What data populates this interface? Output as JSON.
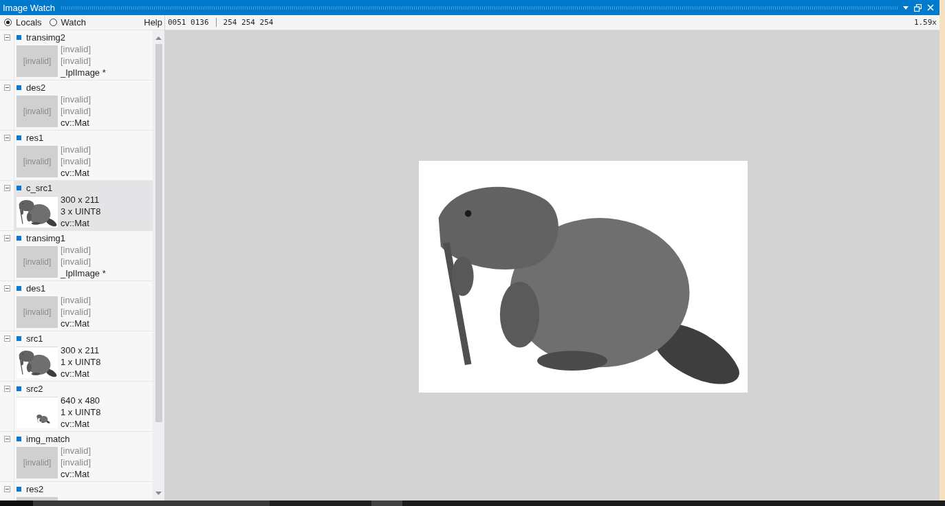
{
  "window": {
    "title": "Image Watch"
  },
  "view_modes": [
    {
      "label": "Locals",
      "selected": true
    },
    {
      "label": "Watch",
      "selected": false
    }
  ],
  "help": "Help",
  "pixel_info": {
    "coordinates": "0051 0136",
    "values": "254 254 254",
    "zoom": "1.59x"
  },
  "variables": [
    {
      "name": "transimg2",
      "expanded": true,
      "selected": false,
      "valid": false,
      "thumbnail": {
        "kind": "placeholder",
        "text": "[invalid]"
      },
      "size": "[invalid]",
      "format": "[invalid]",
      "type": "_IplImage *"
    },
    {
      "name": "des2",
      "expanded": true,
      "selected": false,
      "valid": false,
      "thumbnail": {
        "kind": "placeholder",
        "text": "[invalid]"
      },
      "size": "[invalid]",
      "format": "[invalid]",
      "type": "cv::Mat"
    },
    {
      "name": "res1",
      "expanded": true,
      "selected": false,
      "valid": false,
      "thumbnail": {
        "kind": "placeholder",
        "text": "[invalid]"
      },
      "size": "[invalid]",
      "format": "[invalid]",
      "type": "cv::Mat"
    },
    {
      "name": "c_src1",
      "expanded": true,
      "selected": true,
      "valid": true,
      "thumbnail": {
        "kind": "image"
      },
      "size": "300 x 211",
      "format": "3 x UINT8",
      "type": "cv::Mat"
    },
    {
      "name": "transimg1",
      "expanded": true,
      "selected": false,
      "valid": false,
      "thumbnail": {
        "kind": "placeholder",
        "text": "[invalid]"
      },
      "size": "[invalid]",
      "format": "[invalid]",
      "type": "_IplImage *"
    },
    {
      "name": "des1",
      "expanded": true,
      "selected": false,
      "valid": false,
      "thumbnail": {
        "kind": "placeholder",
        "text": "[invalid]"
      },
      "size": "[invalid]",
      "format": "[invalid]",
      "type": "cv::Mat"
    },
    {
      "name": "src1",
      "expanded": true,
      "selected": false,
      "valid": true,
      "thumbnail": {
        "kind": "image"
      },
      "size": "300 x 211",
      "format": "1 x UINT8",
      "type": "cv::Mat"
    },
    {
      "name": "src2",
      "expanded": true,
      "selected": false,
      "valid": true,
      "thumbnail": {
        "kind": "inset"
      },
      "size": "640 x 480",
      "format": "1 x UINT8",
      "type": "cv::Mat"
    },
    {
      "name": "img_match",
      "expanded": true,
      "selected": false,
      "valid": false,
      "thumbnail": {
        "kind": "placeholder",
        "text": "[invalid]"
      },
      "size": "[invalid]",
      "format": "[invalid]",
      "type": "cv::Mat"
    },
    {
      "name": "res2",
      "expanded": true,
      "selected": false,
      "thumbnail": {
        "kind": "placeholder"
      }
    }
  ]
}
